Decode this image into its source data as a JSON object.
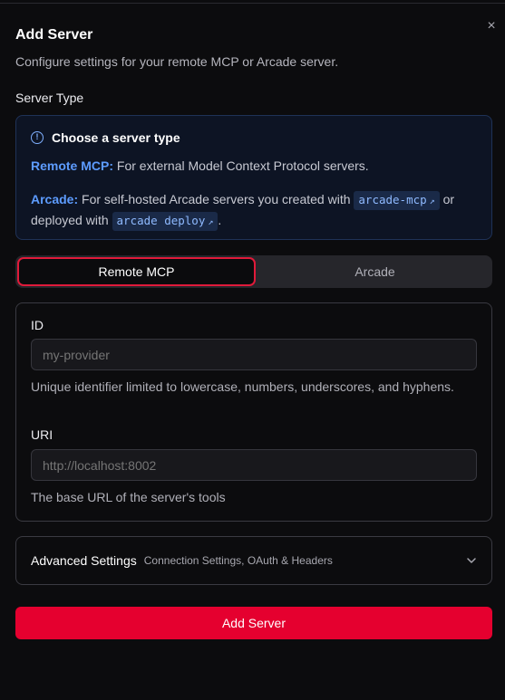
{
  "dialog": {
    "title": "Add Server",
    "subtitle": "Configure settings for your remote MCP or Arcade server.",
    "close_icon": "×"
  },
  "server_type": {
    "label": "Server Type",
    "info": {
      "icon": "!",
      "heading": "Choose a server type",
      "remote_name": "Remote MCP:",
      "remote_desc": " For external Model Context Protocol servers.",
      "arcade_name": "Arcade:",
      "arcade_desc": " For self-hosted Arcade servers you created with ",
      "chip1": "arcade-mcp",
      "or_text": " or deployed with ",
      "chip2": "arcade deploy",
      "end": "."
    },
    "tabs": [
      {
        "label": "Remote MCP",
        "active": true
      },
      {
        "label": "Arcade",
        "active": false
      }
    ]
  },
  "form": {
    "id_label": "ID",
    "id_value": "my-provider",
    "id_help": "Unique identifier limited to lowercase, numbers, underscores, and hyphens.",
    "uri_label": "URI",
    "uri_value": "http://localhost:8002",
    "uri_help": "The base URL of the server's tools"
  },
  "advanced": {
    "title": "Advanced Settings",
    "subtitle": "Connection Settings, OAuth & Headers"
  },
  "submit_label": "Add Server",
  "colors": {
    "accent": "#e5002f",
    "link": "#5d9cff",
    "info_bg": "#0d1424"
  }
}
